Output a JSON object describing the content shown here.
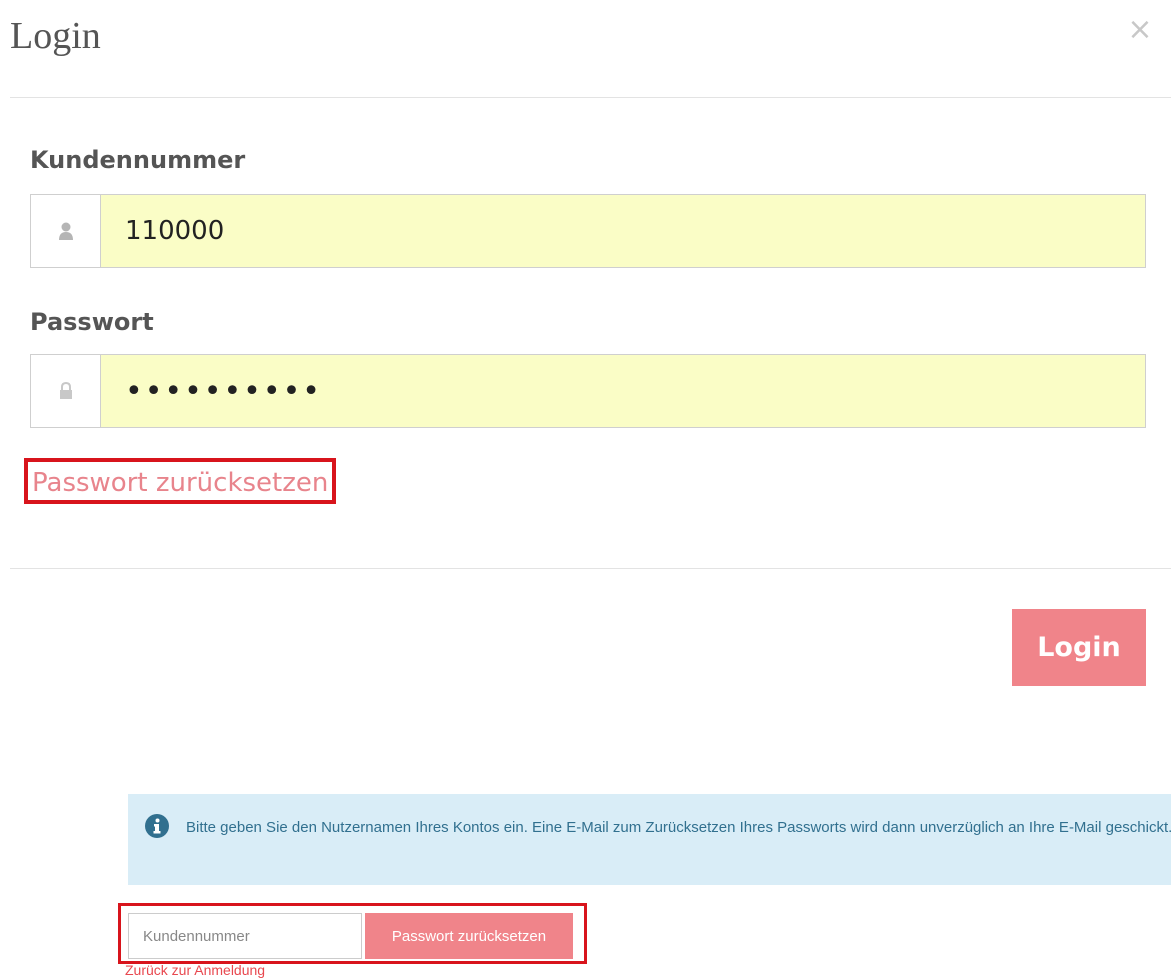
{
  "modal": {
    "title": "Login",
    "close_symbol": "×"
  },
  "form": {
    "username": {
      "label": "Kundennummer",
      "value": "110000",
      "icon": "user-icon"
    },
    "password": {
      "label": "Passwort",
      "value": "••••••••••",
      "icon": "lock-icon"
    },
    "forgot_link": "Passwort zurücksetzen"
  },
  "footer": {
    "login_label": "Login"
  },
  "reset_panel": {
    "info_icon": "info-icon",
    "info_text": "Bitte geben Sie den Nutzernamen Ihres Kontos ein. Eine E-Mail zum Zurücksetzen Ihres Passworts wird dann unverzüglich an Ihre E-Mail geschickt.",
    "input_placeholder": "Kundennummer",
    "submit_label": "Passwort zurücksetzen",
    "back_link": "Zurück zur Anmeldung"
  },
  "colors": {
    "accent": "#f0848a",
    "highlight_border": "#d8141c",
    "autofill": "#fafdc6",
    "info_bg": "#d9edf7",
    "info_text": "#31708f"
  }
}
